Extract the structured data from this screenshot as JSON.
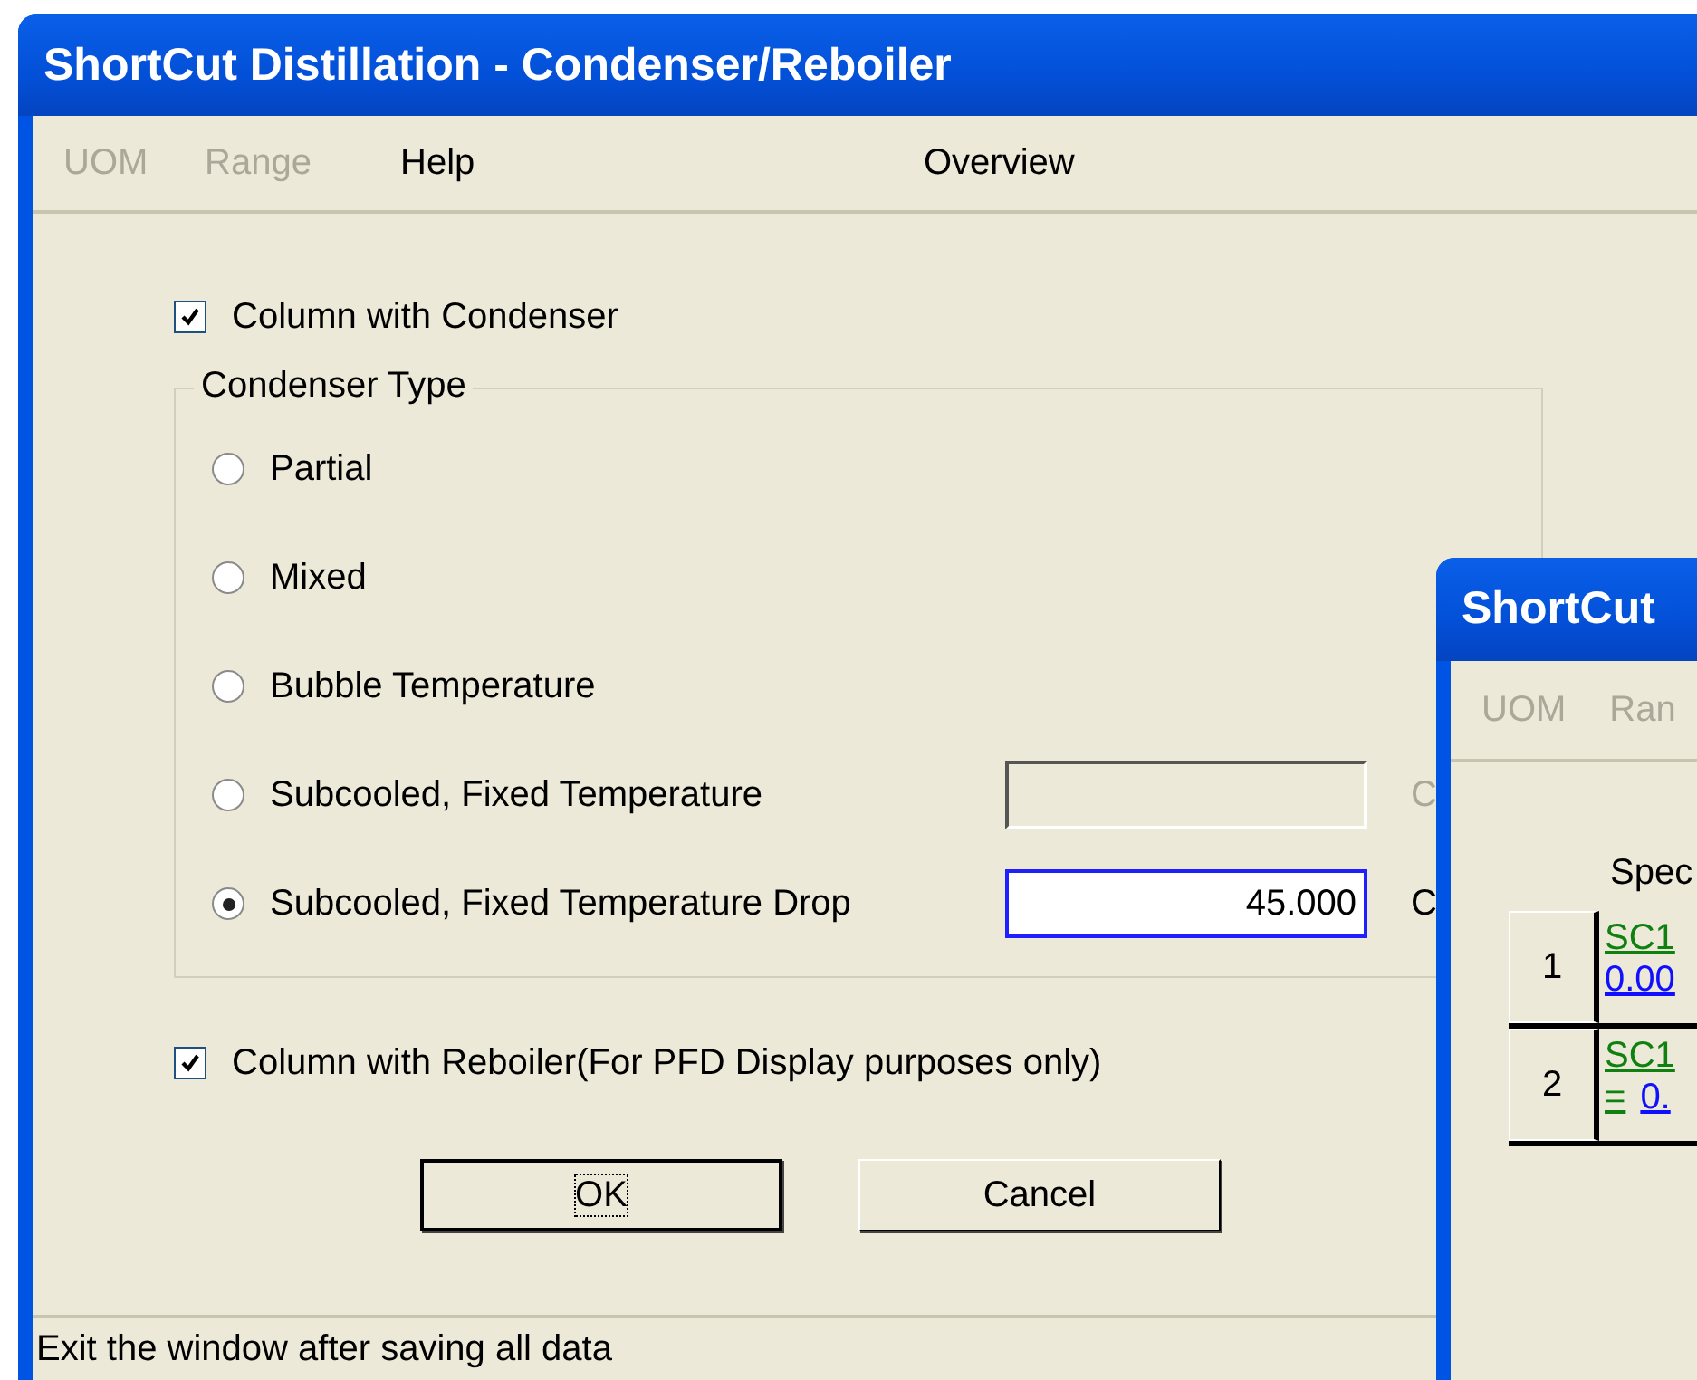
{
  "window": {
    "title": "ShortCut Distillation - Condenser/Reboiler"
  },
  "menu": [
    {
      "label": "UOM",
      "disabled": true
    },
    {
      "label": "Range",
      "disabled": true
    },
    {
      "label": "Help",
      "disabled": false
    },
    {
      "label": "Overview",
      "disabled": false
    }
  ],
  "condenser_checkbox": {
    "label": "Column with Condenser",
    "checked": true
  },
  "condenser_type": {
    "title": "Condenser Type",
    "options": [
      {
        "label": "Partial",
        "selected": false
      },
      {
        "label": "Mixed",
        "selected": false
      },
      {
        "label": "Bubble Temperature",
        "selected": false
      },
      {
        "label": "Subcooled, Fixed Temperature",
        "selected": false,
        "field": {
          "disabled": true,
          "unit": "C"
        }
      },
      {
        "label": "Subcooled, Fixed Temperature Drop",
        "selected": true,
        "field": {
          "value": "45.000",
          "disabled": false,
          "unit": "C"
        }
      }
    ]
  },
  "reboiler_checkbox": {
    "label": "Column with Reboiler(For PFD Display purposes only)",
    "checked": true
  },
  "buttons": [
    {
      "label": "OK",
      "focused": true
    },
    {
      "label": "Cancel",
      "focused": false
    }
  ],
  "status_bar": "Exit the window after saving all data",
  "second_window": {
    "title": "ShortCut",
    "menu": [
      {
        "label": "UOM",
        "disabled": true
      },
      {
        "label": "Ran",
        "disabled": true
      }
    ],
    "header": "Spec",
    "rows": [
      {
        "index": "1",
        "line_1": "SC1",
        "line_2": "0.00"
      },
      {
        "index": "2",
        "line_1": "SC1",
        "line_2": "0.",
        "line_2_prefix": "="
      }
    ]
  }
}
